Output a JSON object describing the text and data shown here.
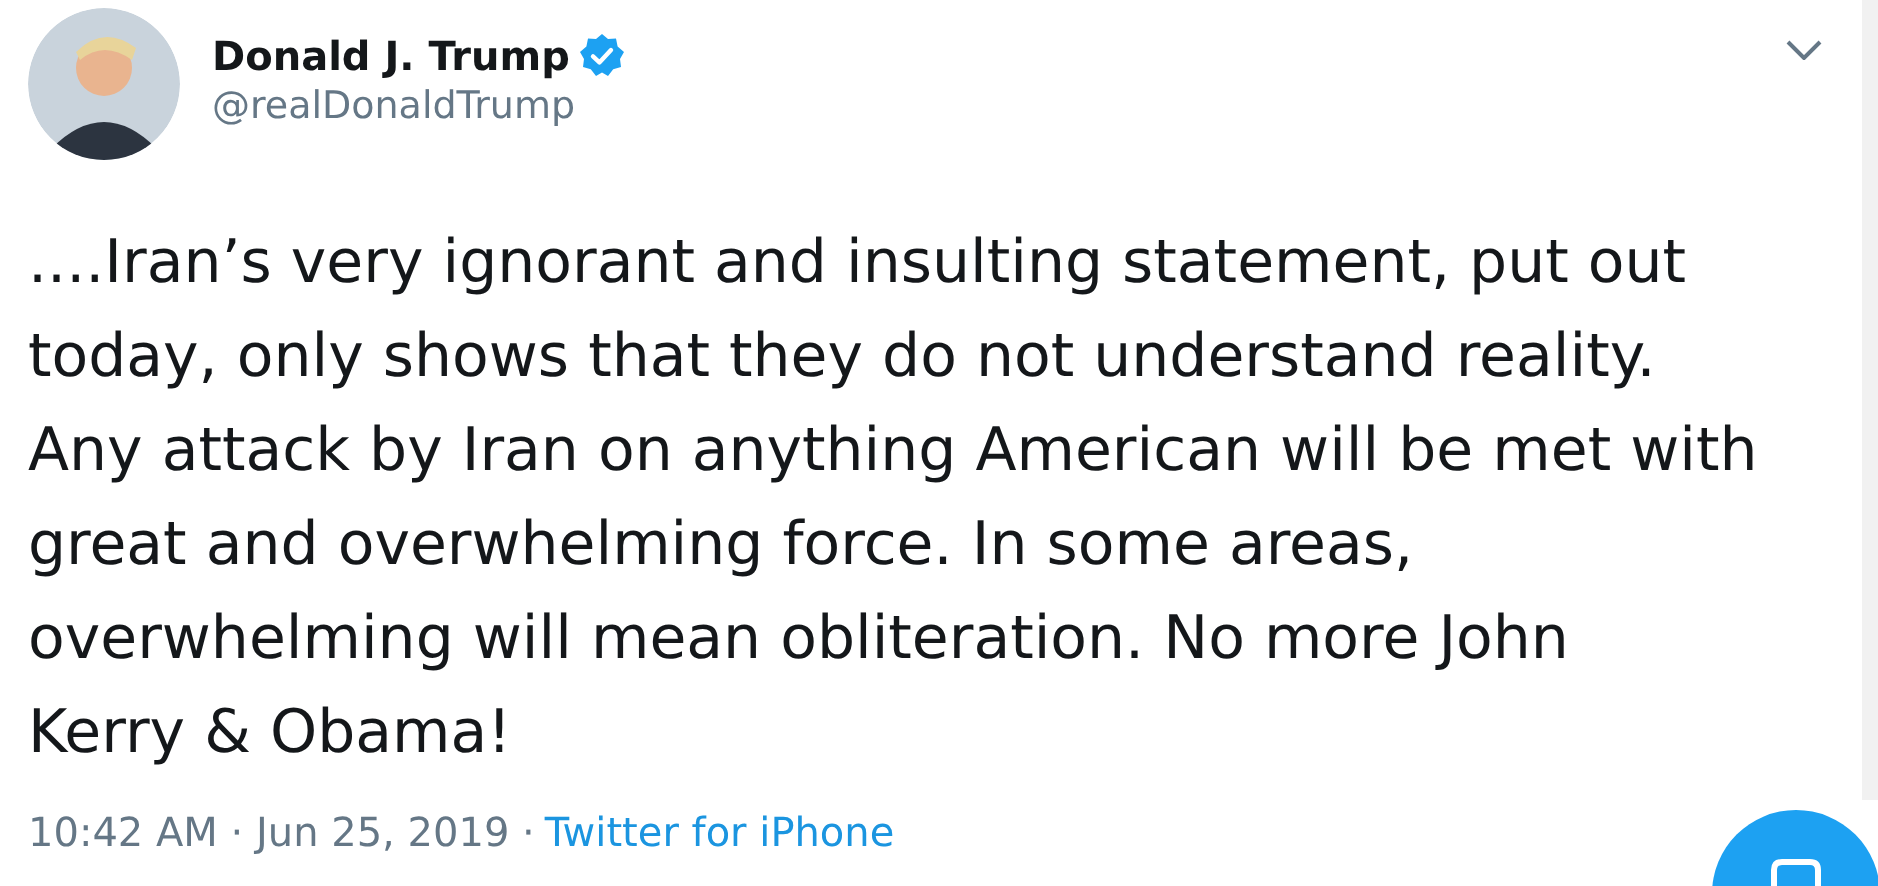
{
  "tweet": {
    "author": {
      "name": "Donald J. Trump",
      "verified": true,
      "handle": "@realDonaldTrump"
    },
    "text": "....Iran’s very ignorant and insulting statement, put out\ntoday, only shows that they do not understand reality.\nAny attack by Iran on anything American will be met with\ngreat and overwhelming force. In some areas,\noverwhelming will mean obliteration. No more John\nKerry & Obama!",
    "time": "10:42 AM · Jun 25, 2019 ·",
    "source": "Twitter for iPhone"
  }
}
